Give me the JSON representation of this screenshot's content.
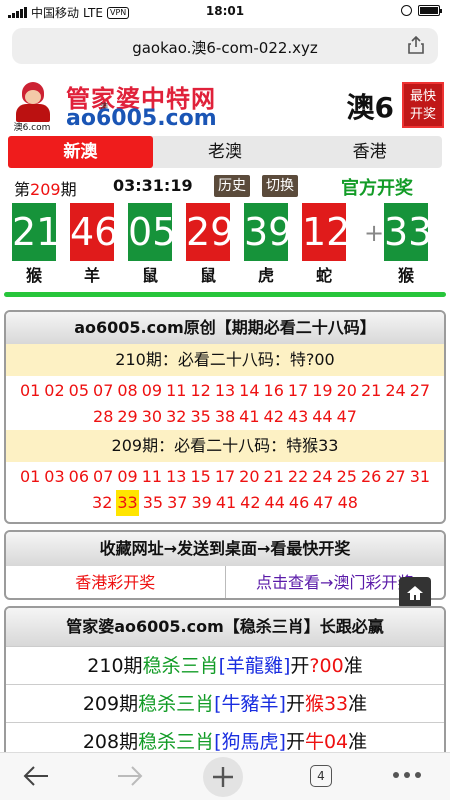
{
  "status": {
    "carrier": "中国移动",
    "network": "LTE",
    "vpn": "VPN",
    "time": "18:01"
  },
  "browser": {
    "url": "gaokao.澳6-com-022.xyz",
    "tab_count": "4"
  },
  "banner": {
    "title": "管家婆中特网",
    "domain": "ao6005.com",
    "small": "澳",
    "avatar_site": "澳6.com",
    "right_text": "澳6",
    "stamp": [
      "最快",
      "开奖"
    ]
  },
  "tabs": [
    {
      "label": "新澳",
      "active": true
    },
    {
      "label": "老澳",
      "active": false
    },
    {
      "label": "香港",
      "active": false
    }
  ],
  "period": {
    "prefix": "第",
    "number": "209",
    "suffix": "期",
    "countdown": "03:31:19",
    "history_btn": "历史",
    "switch_btn": "切换",
    "official": "官方开奖"
  },
  "draw": {
    "balls": [
      {
        "num": "21",
        "color": "green",
        "zodiac": "猴"
      },
      {
        "num": "46",
        "color": "red",
        "zodiac": "羊"
      },
      {
        "num": "05",
        "color": "green",
        "zodiac": "鼠"
      },
      {
        "num": "29",
        "color": "red",
        "zodiac": "鼠"
      },
      {
        "num": "39",
        "color": "green",
        "zodiac": "虎"
      },
      {
        "num": "12",
        "color": "red",
        "zodiac": "蛇"
      }
    ],
    "plus": "+",
    "special": {
      "num": "33",
      "color": "green",
      "zodiac": "猴"
    }
  },
  "box1": {
    "header": "ao6005.com原创【期期必看二十八码】",
    "p210": {
      "title": "210期：必看二十八码：特?00",
      "numbers": [
        "01",
        "02",
        "05",
        "07",
        "08",
        "09",
        "11",
        "12",
        "13",
        "14",
        "16",
        "17",
        "19",
        "20",
        "21",
        "24",
        "27",
        "28",
        "29",
        "30",
        "32",
        "35",
        "38",
        "41",
        "42",
        "43",
        "44",
        "47"
      ]
    },
    "p209": {
      "title": "209期：必看二十八码：特猴33",
      "numbers": [
        "01",
        "03",
        "06",
        "07",
        "09",
        "11",
        "13",
        "15",
        "17",
        "20",
        "21",
        "22",
        "24",
        "25",
        "26",
        "27",
        "31",
        "32",
        "33",
        "35",
        "37",
        "39",
        "41",
        "42",
        "44",
        "46",
        "47",
        "48"
      ],
      "highlight": "33"
    }
  },
  "box2": {
    "header": "收藏网址→发送到桌面→看最快开奖",
    "link1": "香港彩开奖",
    "link2": "点击查看→澳门彩开奖"
  },
  "box3": {
    "header": "管家婆ao6005.com【稳杀三肖】长跟必赢",
    "rows": [
      {
        "period": "210期",
        "label": "稳杀三肖",
        "animals": "[羊龍雞]",
        "open": "开",
        "result": "?00",
        "tail": "准"
      },
      {
        "period": "209期",
        "label": "稳杀三肖",
        "animals": "[牛豬羊]",
        "open": "开",
        "result": "猴33",
        "tail": "准"
      },
      {
        "period": "208期",
        "label": "稳杀三肖",
        "animals": "[狗馬虎]",
        "open": "开",
        "result": "牛04",
        "tail": "准"
      }
    ]
  },
  "colors": {
    "red": "#e01b1b",
    "green": "#16933a",
    "accent_green": "#139c27",
    "blue": "#1a2ee0"
  }
}
